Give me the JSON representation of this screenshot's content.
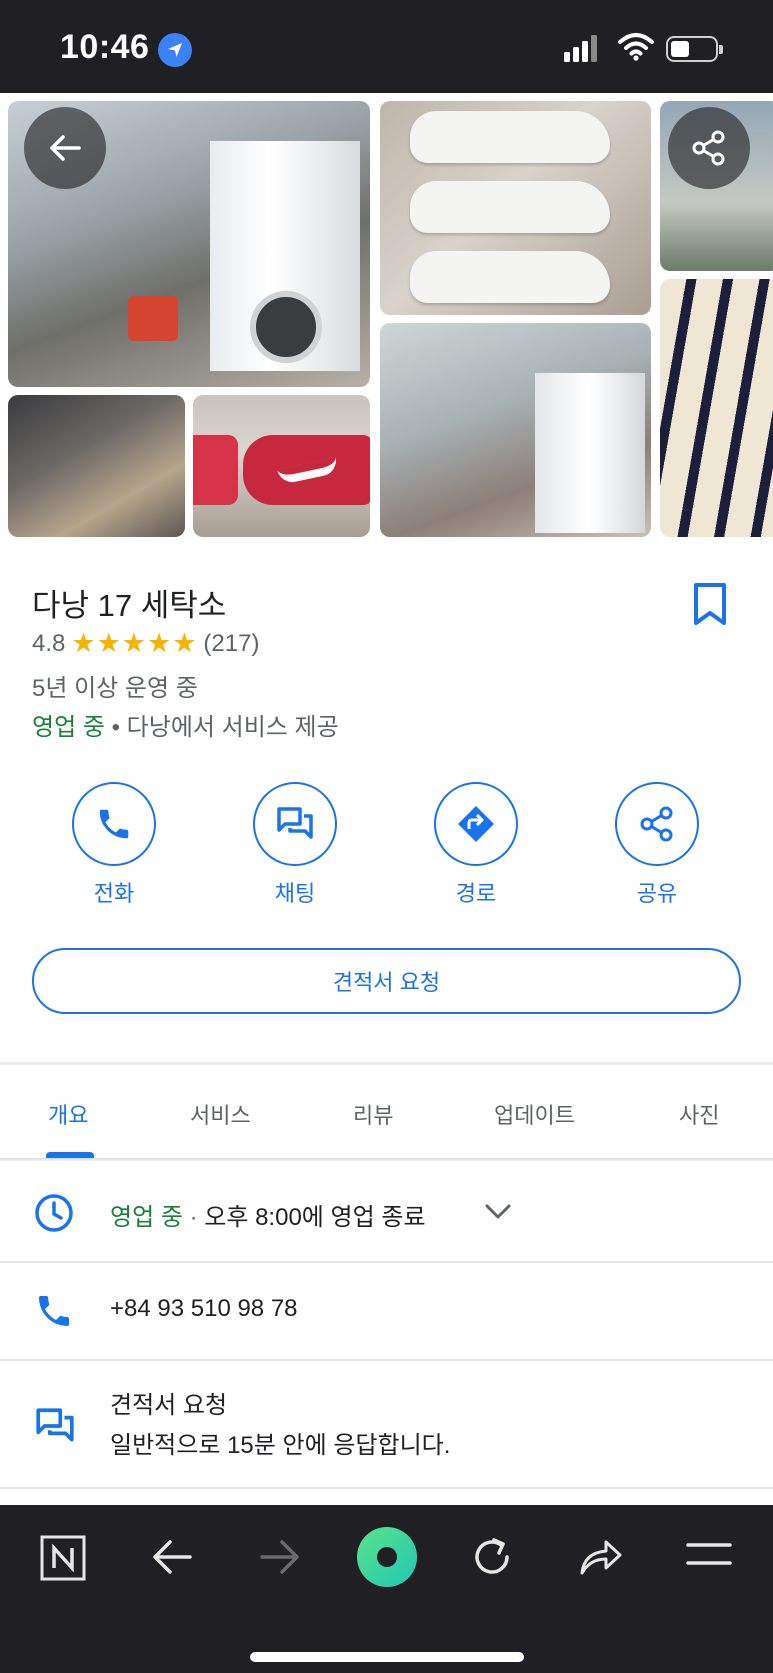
{
  "status_bar": {
    "time": "10:46"
  },
  "place": {
    "name": "다낭 17 세탁소",
    "rating": "4.8",
    "stars": "★★★★★",
    "review_count": "(217)",
    "years": "5년 이상 운영 중",
    "open_status": "영업 중",
    "service_area": " • 다낭에서 서비스 제공"
  },
  "actions": [
    {
      "label": "전화",
      "icon": "phone-icon"
    },
    {
      "label": "채팅",
      "icon": "chat-icon"
    },
    {
      "label": "경로",
      "icon": "directions-icon"
    },
    {
      "label": "공유",
      "icon": "share-icon"
    }
  ],
  "quote_button": "견적서 요청",
  "tabs": [
    "개요",
    "서비스",
    "리뷰",
    "업데이트",
    "사진"
  ],
  "active_tab": "개요",
  "hours": {
    "status": "영업 중",
    "separator": " · ",
    "closing": "오후 8:00에 영업 종료"
  },
  "phone": "+84 93 510 98 78",
  "quote_row": {
    "title": "견적서 요청",
    "subtitle": "일반적으로 15분 안에 응답합니다."
  },
  "colors": {
    "accent": "#1a73e8",
    "open_green": "#188038",
    "star": "#f4b400",
    "bar_dark": "#1f1f24"
  }
}
